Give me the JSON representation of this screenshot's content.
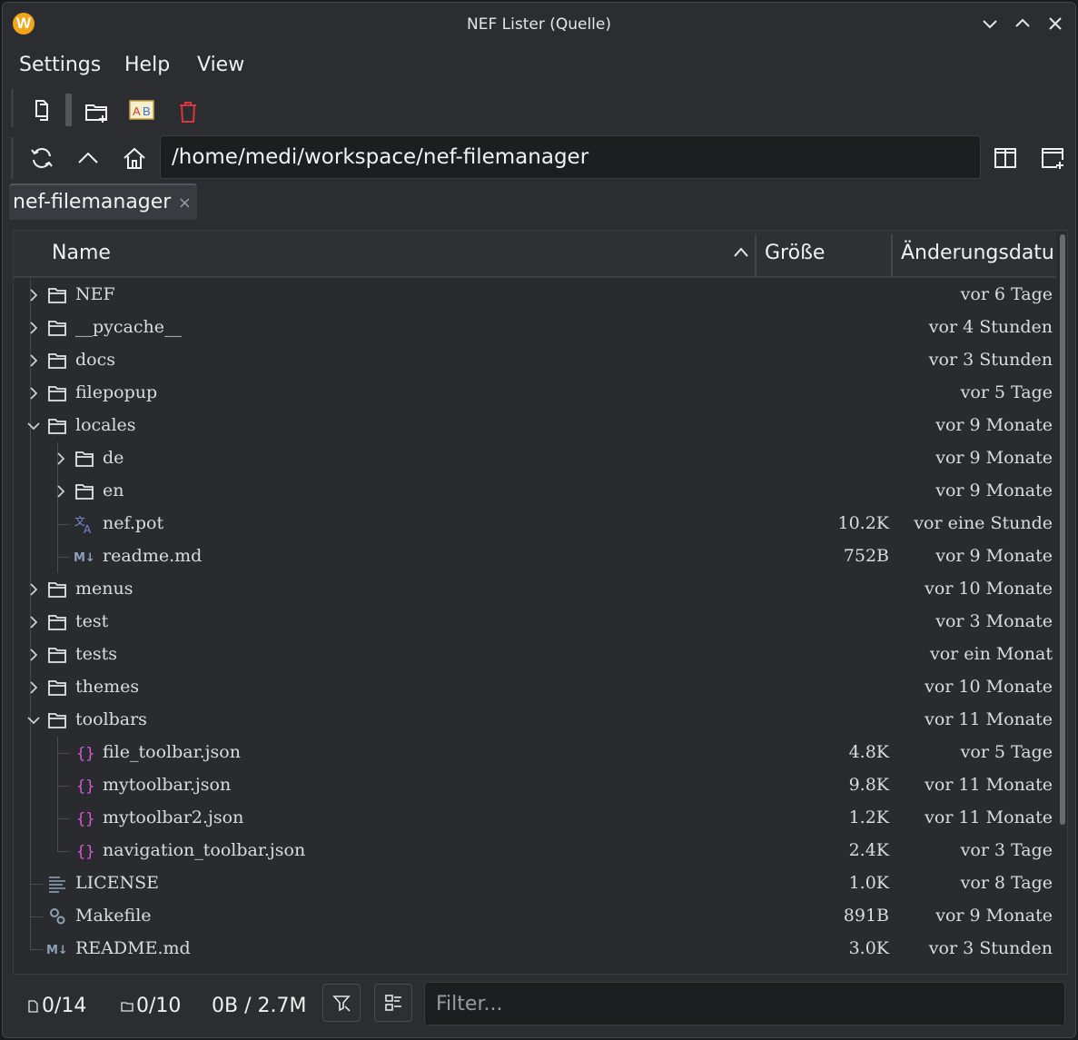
{
  "window": {
    "title": "NEF Lister (Quelle)"
  },
  "menu": {
    "items": [
      "Settings",
      "Help",
      "View"
    ]
  },
  "path": {
    "value": "/home/medi/workspace/nef-filemanager"
  },
  "tab": {
    "label": "nef-filemanager",
    "close": "×"
  },
  "columns": {
    "name": "Name",
    "size": "Größe",
    "modified": "Änderungsdatu"
  },
  "rows": [
    {
      "name": "NEF",
      "size": "",
      "date": "vor 6 Tage",
      "type": "folder",
      "depth": 0,
      "state": "collapsed"
    },
    {
      "name": "__pycache__",
      "size": "",
      "date": "vor 4 Stunden",
      "type": "folder",
      "depth": 0,
      "state": "collapsed"
    },
    {
      "name": "docs",
      "size": "",
      "date": "vor 3 Stunden",
      "type": "folder",
      "depth": 0,
      "state": "collapsed"
    },
    {
      "name": "filepopup",
      "size": "",
      "date": "vor 5 Tage",
      "type": "folder",
      "depth": 0,
      "state": "collapsed"
    },
    {
      "name": "locales",
      "size": "",
      "date": "vor 9 Monate",
      "type": "folder",
      "depth": 0,
      "state": "expanded"
    },
    {
      "name": "de",
      "size": "",
      "date": "vor 9 Monate",
      "type": "folder",
      "depth": 1,
      "state": "collapsed"
    },
    {
      "name": "en",
      "size": "",
      "date": "vor 9 Monate",
      "type": "folder",
      "depth": 1,
      "state": "collapsed"
    },
    {
      "name": "nef.pot",
      "size": "10.2K",
      "date": "vor eine Stunde",
      "type": "translate",
      "depth": 1,
      "state": "leaf"
    },
    {
      "name": "readme.md",
      "size": "752B",
      "date": "vor 9 Monate",
      "type": "markdown",
      "depth": 1,
      "state": "leaf"
    },
    {
      "name": "menus",
      "size": "",
      "date": "vor 10 Monate",
      "type": "folder",
      "depth": 0,
      "state": "collapsed"
    },
    {
      "name": "test",
      "size": "",
      "date": "vor 3 Monate",
      "type": "folder",
      "depth": 0,
      "state": "collapsed"
    },
    {
      "name": "tests",
      "size": "",
      "date": "vor ein Monat",
      "type": "folder",
      "depth": 0,
      "state": "collapsed"
    },
    {
      "name": "themes",
      "size": "",
      "date": "vor 10 Monate",
      "type": "folder",
      "depth": 0,
      "state": "collapsed"
    },
    {
      "name": "toolbars",
      "size": "",
      "date": "vor 11 Monate",
      "type": "folder",
      "depth": 0,
      "state": "expanded"
    },
    {
      "name": "file_toolbar.json",
      "size": "4.8K",
      "date": "vor 5 Tage",
      "type": "json",
      "depth": 1,
      "state": "leaf"
    },
    {
      "name": "mytoolbar.json",
      "size": "9.8K",
      "date": "vor 11 Monate",
      "type": "json",
      "depth": 1,
      "state": "leaf"
    },
    {
      "name": "mytoolbar2.json",
      "size": "1.2K",
      "date": "vor 11 Monate",
      "type": "json",
      "depth": 1,
      "state": "leaf"
    },
    {
      "name": "navigation_toolbar.json",
      "size": "2.4K",
      "date": "vor 3 Tage",
      "type": "json",
      "depth": 1,
      "state": "leaf-last"
    },
    {
      "name": "LICENSE",
      "size": "1.0K",
      "date": "vor 8 Tage",
      "type": "text",
      "depth": 0,
      "state": "leaf"
    },
    {
      "name": "Makefile",
      "size": "891B",
      "date": "vor 9 Monate",
      "type": "make",
      "depth": 0,
      "state": "leaf"
    },
    {
      "name": "README.md",
      "size": "3.0K",
      "date": "vor 3 Stunden",
      "type": "markdown",
      "depth": 0,
      "state": "leaf"
    }
  ],
  "status": {
    "files": "0/14",
    "folders": "0/10",
    "size": "0B / 2.7M"
  },
  "filter": {
    "placeholder": "Filter..."
  },
  "colors": {
    "background": "#2c2d31",
    "accent": "#f2a617",
    "json_icon": "#d65ad6",
    "delete_icon": "#d9363e"
  }
}
